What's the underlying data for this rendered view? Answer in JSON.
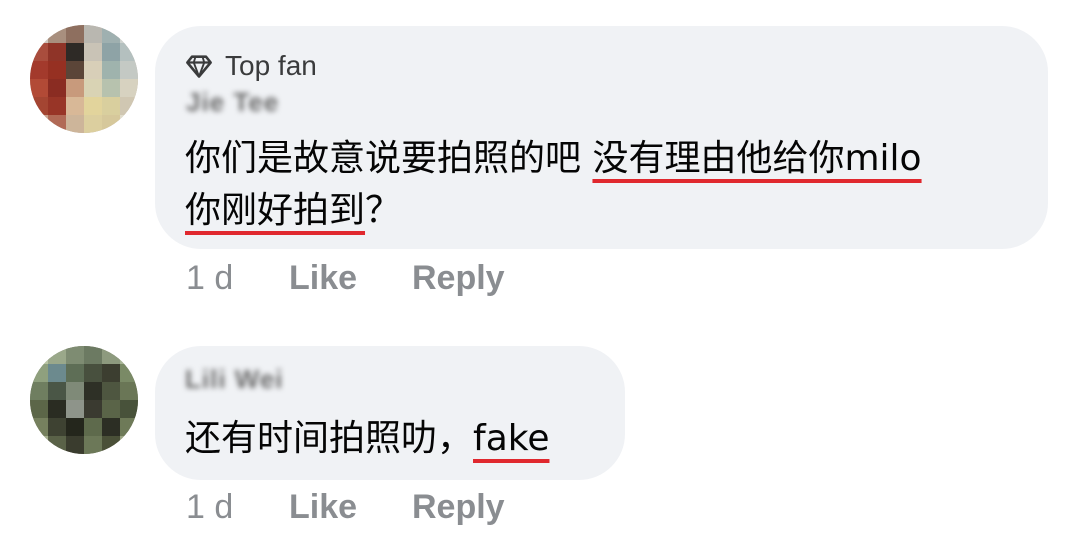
{
  "comments": [
    {
      "badge": "Top fan",
      "badge_icon": "diamond-icon",
      "author": "Jie Tee",
      "text_line1_plain": "你们是故意说要拍照的吧 ",
      "text_line1_underlined": "没有理由他给你milo",
      "text_line2_underlined": "你刚好拍到",
      "text_line2_plain": "？",
      "time": "1 d",
      "like_label": "Like",
      "reply_label": "Reply"
    },
    {
      "author": "Lili Wei",
      "text_plain": "还有时间拍照叻，",
      "text_underlined": "fake",
      "time": "1 d",
      "like_label": "Like",
      "reply_label": "Reply"
    }
  ],
  "colors": {
    "bubble": "#f0f2f5",
    "underline": "#e0282e",
    "meta": "#8a8d91",
    "text": "#050505"
  }
}
